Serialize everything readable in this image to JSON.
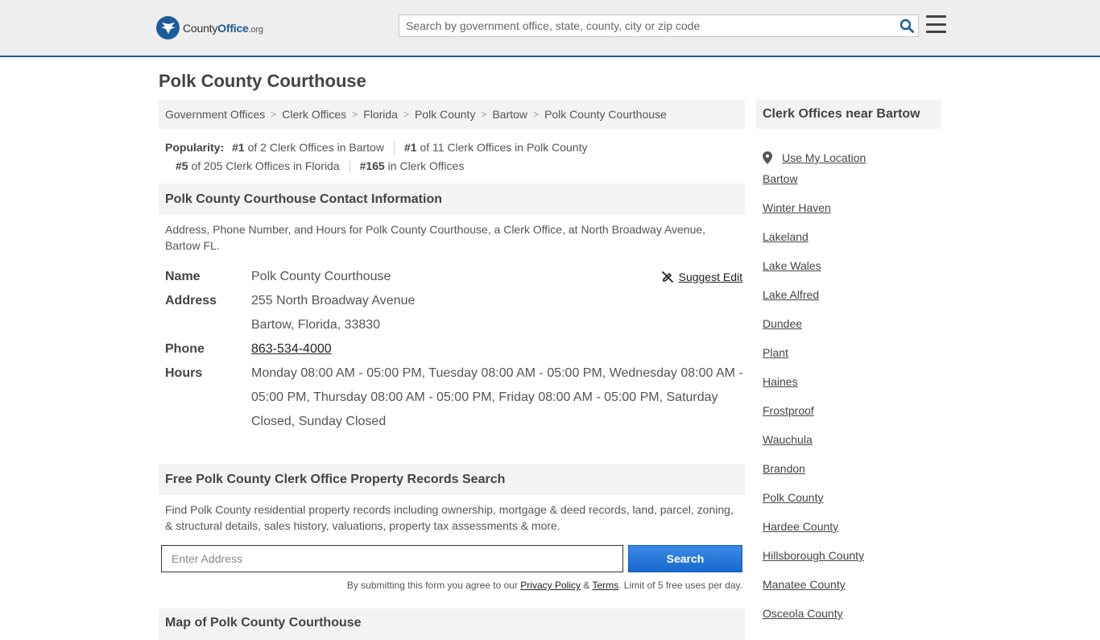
{
  "header": {
    "logo_word1": "County",
    "logo_word2": "Office",
    "logo_tld": ".org",
    "search_placeholder": "Search by government office, state, county, city or zip code"
  },
  "page": {
    "title": "Polk County Courthouse"
  },
  "breadcrumbs": [
    "Government Offices",
    "Clerk Offices",
    "Florida",
    "Polk County",
    "Bartow",
    "Polk County Courthouse"
  ],
  "popularity": {
    "label": "Popularity:",
    "items": [
      {
        "rank": "#1",
        "text": "of 2 Clerk Offices in Bartow"
      },
      {
        "rank": "#1",
        "text": "of 11 Clerk Offices in Polk County"
      },
      {
        "rank": "#5",
        "text": "of 205 Clerk Offices in Florida"
      },
      {
        "rank": "#165",
        "text": "in Clerk Offices"
      }
    ]
  },
  "contact": {
    "heading": "Polk County Courthouse Contact Information",
    "description": "Address, Phone Number, and Hours for Polk County Courthouse, a Clerk Office, at North Broadway Avenue, Bartow FL.",
    "suggest_edit": "Suggest Edit",
    "name_label": "Name",
    "name_value": "Polk County Courthouse",
    "address_label": "Address",
    "address_line1": "255 North Broadway Avenue",
    "address_line2": "Bartow, Florida, 33830",
    "phone_label": "Phone",
    "phone_value": "863-534-4000",
    "hours_label": "Hours",
    "hours_value": "Monday 08:00 AM - 05:00 PM, Tuesday 08:00 AM - 05:00 PM, Wednesday 08:00 AM - 05:00 PM, Thursday 08:00 AM - 05:00 PM, Friday 08:00 AM - 05:00 PM, Saturday Closed, Sunday Closed"
  },
  "records": {
    "heading": "Free Polk County Clerk Office Property Records Search",
    "description": "Find Polk County residential property records including ownership, mortgage & deed records, land, parcel, zoning, & structural details, sales history, valuations, property tax assessments & more.",
    "input_placeholder": "Enter Address",
    "button_label": "Search",
    "disclaimer_pre": "By submitting this form you agree to our",
    "privacy_label": "Privacy Policy",
    "amp": "&",
    "terms_label": "Terms",
    "disclaimer_post": ". Limit of 5 free uses per day."
  },
  "next_section": {
    "heading": "Map of Polk County Courthouse"
  },
  "sidebar": {
    "heading": "Clerk Offices near Bartow",
    "use_location": "Use My Location",
    "links": [
      "Bartow",
      "Winter Haven",
      "Lakeland",
      "Lake Wales",
      "Lake Alfred",
      "Dundee",
      "Plant",
      "Haines",
      "Frostproof",
      "Wauchula",
      "Brandon",
      "Polk County",
      "Hardee County",
      "Hillsborough County",
      "Manatee County",
      "Osceola County"
    ]
  },
  "colors": {
    "brand_blue": "#1e5b9a",
    "button_blue": "#1768cf"
  }
}
